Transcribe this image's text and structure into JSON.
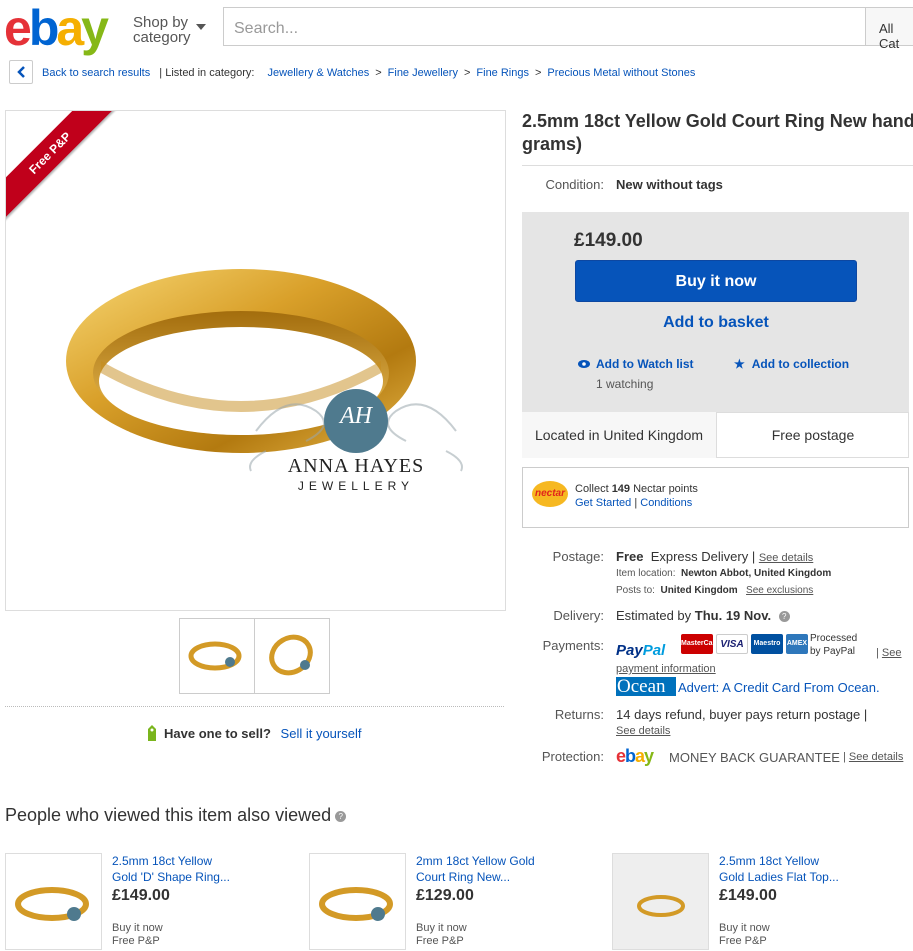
{
  "header": {
    "logo": [
      "e",
      "b",
      "a",
      "y"
    ],
    "logo_colors": [
      "#e53238",
      "#0064d2",
      "#f5af02",
      "#86b817"
    ],
    "shop_by_line1": "Shop by",
    "shop_by_line2": "category",
    "search_placeholder": "Search...",
    "category_select": "All Cat"
  },
  "breadcrumb": {
    "back": "Back to search results",
    "listed_in": "| Listed in category:",
    "items": [
      "Jewellery & Watches",
      "Fine Jewellery",
      "Fine Rings",
      "Precious Metal without Stones"
    ],
    "separator": ">"
  },
  "gallery": {
    "ribbon": "Free P&P",
    "brand_line1": "ANNA HAYES",
    "brand_line2": "JEWELLERY",
    "monogram": "AH"
  },
  "sell": {
    "question": "Have one to sell?",
    "link": "Sell it yourself"
  },
  "item": {
    "title_line1": "2.5mm 18ct Yellow Gold Court Ring New hand",
    "title_line2": "grams)",
    "condition_label": "Condition:",
    "condition_value": "New without tags",
    "price": "£149.00",
    "buy_now": "Buy it now",
    "add_to_basket": "Add to basket",
    "add_to_watch": "Add to Watch list",
    "watching": "1 watching",
    "add_to_collection": "Add to collection",
    "location": "Located in United Kingdom",
    "free_postage": "Free postage"
  },
  "nectar": {
    "logo": "nectar",
    "collect_prefix": "Collect",
    "points": "149",
    "collect_suffix": "Nectar points",
    "get_started": "Get Started",
    "sep": "|",
    "conditions": "Conditions"
  },
  "details": {
    "postage_label": "Postage:",
    "postage_free": "Free",
    "postage_type": "Express Delivery",
    "see_details": "See details",
    "item_location_label": "Item location:",
    "item_location": "Newton Abbot, United Kingdom",
    "posts_to_label": "Posts to:",
    "posts_to": "United Kingdom",
    "see_exclusions": "See exclusions",
    "delivery_label": "Delivery:",
    "delivery_prefix": "Estimated by",
    "delivery_date": "Thu. 19 Nov.",
    "payments_label": "Payments:",
    "paypal_1": "Pay",
    "paypal_2": "Pal",
    "cards": [
      "MasterCard",
      "VISA",
      "Maestro",
      "AMEX"
    ],
    "processed": "Processed",
    "by_paypal": "by PayPal",
    "see": "See",
    "payment_information": "payment information",
    "ocean": "Ocean",
    "ocean_advert": "Advert: A Credit Card From Ocean.",
    "returns_label": "Returns:",
    "returns_value": "14 days refund, buyer pays return postage",
    "protection_label": "Protection:",
    "money_back": "MONEY BACK GUARANTEE"
  },
  "also_viewed": {
    "heading": "People who viewed this item also viewed",
    "items": [
      {
        "title1": "2.5mm 18ct Yellow",
        "title2": "Gold 'D' Shape Ring...",
        "price": "£149.00",
        "buy": "Buy it now",
        "pp": "Free P&P"
      },
      {
        "title1": "2mm 18ct Yellow Gold",
        "title2": "Court Ring New...",
        "price": "£129.00",
        "buy": "Buy it now",
        "pp": "Free P&P"
      },
      {
        "title1": "2.5mm 18ct Yellow",
        "title2": "Gold Ladies Flat Top...",
        "price": "£149.00",
        "buy": "Buy it now",
        "pp": "Free P&P"
      }
    ]
  }
}
